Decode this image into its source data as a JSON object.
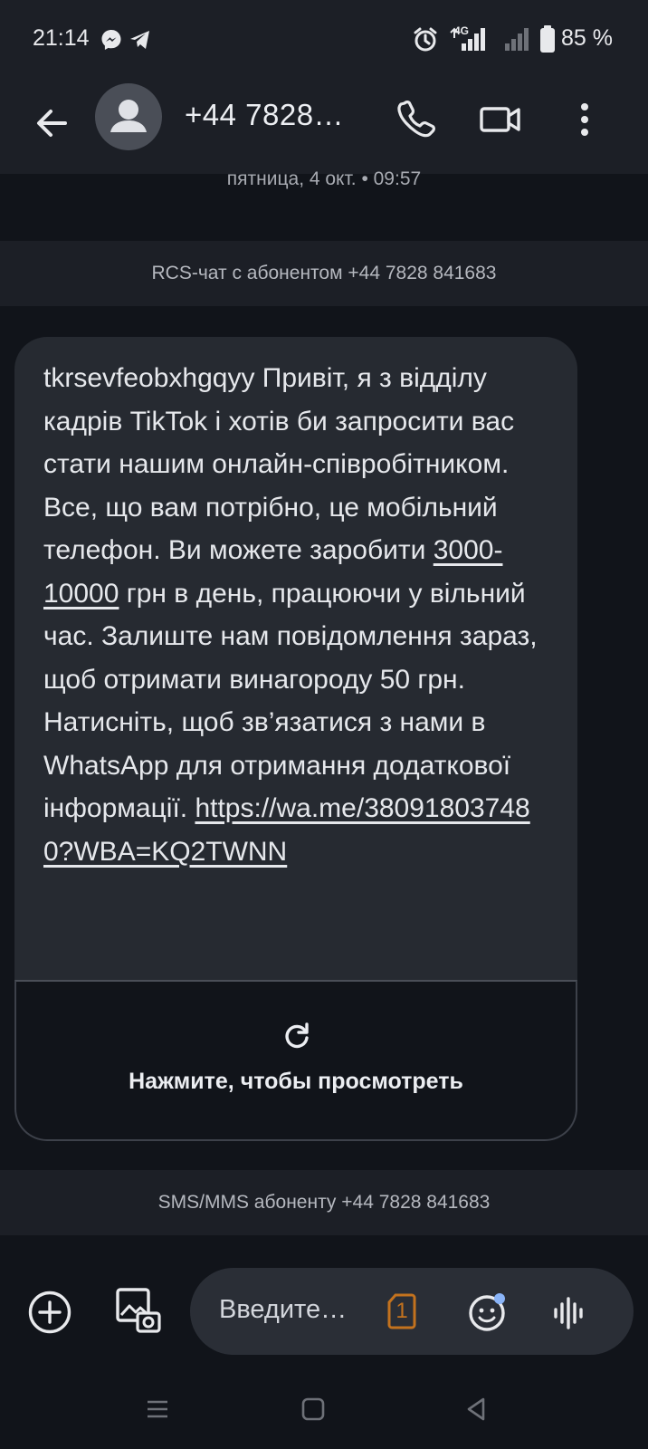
{
  "status_bar": {
    "time": "21:14",
    "battery": "85 %",
    "network": "4G",
    "icons": [
      "messenger-icon",
      "telegram-icon",
      "alarm-icon",
      "signal-icon",
      "battery-icon"
    ]
  },
  "header": {
    "title": "+44 7828…",
    "icons": [
      "back-arrow-icon",
      "avatar-person-icon",
      "phone-icon",
      "video-call-icon",
      "more-vert-icon"
    ]
  },
  "conversation": {
    "date_separator": "пятница, 4 окт. • 09:57",
    "rcs_notice": "RCS-чат с абонентом +44 7828 841683",
    "message": {
      "text_part1": "tkrsevfeobxhgqyy Привіт, я з відділу кадрів TikTok і хотів би запросити вас стати нашим онлайн-співробітником. Все, що вам потрібно, це мобільний телефон. Ви можете заробити ",
      "amount_link": "3000-10000",
      "text_part2": " грн в день, працюючи у вільний час. Залиште нам повідомлення зараз, щоб отримати винагороду 50 грн. Натисніть, щоб зв’язатися з нами в WhatsApp для отримання додаткової інформації. ",
      "url": "https://wa.me/380918037480?WBA=KQ2TWNN"
    },
    "preview": {
      "label": "Нажмите, чтобы просмотреть",
      "icon": "refresh-icon"
    },
    "sms_notice": "SMS/MMS абоненту +44 7828 841683"
  },
  "compose": {
    "placeholder": "Введите…",
    "sim_badge": "1",
    "icons": [
      "add-icon",
      "gallery-icon",
      "sim-icon",
      "emoji-icon",
      "voice-icon"
    ]
  },
  "nav": {
    "icons": [
      "recents-icon",
      "home-icon",
      "back-icon"
    ]
  },
  "colors": {
    "background": "#11141a",
    "surface": "#1c1f26",
    "bubble": "#262a31",
    "accent_sim": "#c3721e",
    "badge_dot": "#8ab4f8"
  }
}
